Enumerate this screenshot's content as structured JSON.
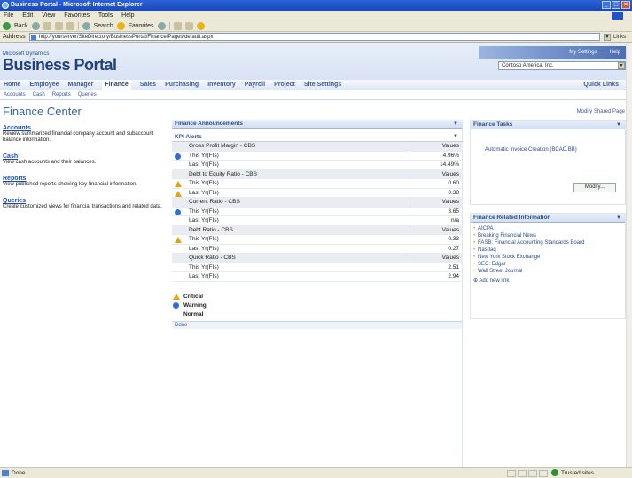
{
  "window": {
    "title": "Business Portal - Microsoft Internet Explorer"
  },
  "menu": [
    "File",
    "Edit",
    "View",
    "Favorites",
    "Tools",
    "Help"
  ],
  "toolbar": {
    "back": "Back",
    "search": "Search",
    "favorites": "Favorites"
  },
  "address": {
    "label": "Address",
    "url": "http://yourserver/SiteDirectory/BusinessPortal/Finance/Pages/default.aspx",
    "links": "Links"
  },
  "header": {
    "brand_small": "Microsoft Dynamics",
    "brand": "Business Portal",
    "toplinks": [
      "My Settings",
      "Help"
    ],
    "site": "Contoso America, Inc."
  },
  "nav": {
    "tabs": [
      "Home",
      "Employee",
      "Manager",
      "Finance",
      "Sales",
      "Purchasing",
      "Inventory",
      "Payroll",
      "Project",
      "Site Settings"
    ],
    "selected": "Finance",
    "quick_links": "Quick Links",
    "sub": [
      "Accounts",
      "Cash",
      "Reports",
      "Queries"
    ]
  },
  "page": {
    "title": "Finance Center",
    "modify": "Modify Shared Page"
  },
  "left": [
    {
      "link": "Accounts",
      "desc": "Review summarized financial company account and subaccount balance information."
    },
    {
      "link": "Cash",
      "desc": "View cash accounts and their balances."
    },
    {
      "link": "Reports",
      "desc": "View published reports showing key financial information."
    },
    {
      "link": "Queries",
      "desc": "Create customized views for financial transactions and related data."
    }
  ],
  "announcements": {
    "title": "Finance Announcements"
  },
  "kpi": {
    "title": "KPI Alerts",
    "value_header": "Values",
    "groups": [
      {
        "name": "Gross Profit Margin - CBS",
        "rows": [
          {
            "label": "This Yr(FIs)",
            "value": "4.96%",
            "status": "warning"
          },
          {
            "label": "Last Yr(FIs)",
            "value": "14.49%",
            "status": "normal"
          }
        ]
      },
      {
        "name": "Debt to Equity Ratio - CBS",
        "rows": [
          {
            "label": "This Yr(FIs)",
            "value": "0.60",
            "status": "critical"
          },
          {
            "label": "Last Yr(FIs)",
            "value": "0.38",
            "status": "critical"
          }
        ]
      },
      {
        "name": "Current Ratio - CBS",
        "rows": [
          {
            "label": "This Yr(FIs)",
            "value": "3.65",
            "status": "warning"
          },
          {
            "label": "Last Yr(FIs)",
            "value": "n/a",
            "status": "normal"
          }
        ]
      },
      {
        "name": "Debt Ratio - CBS",
        "rows": [
          {
            "label": "This Yr(FIs)",
            "value": "0.33",
            "status": "critical"
          },
          {
            "label": "Last Yr(FIs)",
            "value": "0.27",
            "status": "normal"
          }
        ]
      },
      {
        "name": "Quick Ratio - CBS",
        "rows": [
          {
            "label": "This Yr(FIs)",
            "value": "2.51",
            "status": "normal"
          },
          {
            "label": "Last Yr(FIs)",
            "value": "2.94",
            "status": "normal"
          }
        ]
      }
    ],
    "legend": [
      {
        "label": "Critical",
        "status": "critical"
      },
      {
        "label": "Warning",
        "status": "warning"
      },
      {
        "label": "Normal",
        "status": "normal"
      }
    ],
    "done": "Done"
  },
  "tasks": {
    "title": "Finance Tasks",
    "items": [
      "Automatic Invoice Creation (BCAC.BB)"
    ],
    "button": "Modify..."
  },
  "related": {
    "title": "Finance Related Information",
    "items": [
      "AICPA",
      "Breaking Financial News",
      "FASB: Financial Accounting Standards Board",
      "Nasdaq",
      "New York Stock Exchange",
      "SEC: Edgar",
      "Wall Street Journal"
    ],
    "add": "Add new link"
  },
  "status": {
    "text": "Done",
    "zone": "Trusted sites"
  },
  "colors": {
    "critical": "#e3a417",
    "warning": "#2e6fd1",
    "accent": "#22407a"
  }
}
